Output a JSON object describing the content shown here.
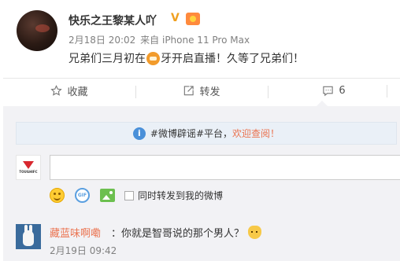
{
  "post": {
    "author": "快乐之王黎某人吖",
    "verified_mark": "V",
    "date": "2月18日 20:02",
    "via": "来自",
    "device": "iPhone 11 Pro Max",
    "text_before": "兄弟们三月初在",
    "emoji": "tiger-emoji",
    "text_after": "牙开启直播！久等了兄弟们！"
  },
  "actions": {
    "favorite": "收藏",
    "repost": "转发",
    "comment_count": "6"
  },
  "comments": {
    "notice_prefix": "#微博辟谣#平台，",
    "notice_link": "欢迎查阅！",
    "input_value": "",
    "repost_label": "同时转发到我的微博",
    "gif_label": "GIF",
    "my_avatar_text": "TOUGHIFC",
    "items": [
      {
        "author": "藏蓝味啊嘞",
        "text": "：你就是智哥说的那个男人？",
        "time": "2月19日 09:42"
      }
    ]
  },
  "colors": {
    "link": "#eb7350",
    "verified": "#f0a020",
    "info": "#4a90d9"
  }
}
